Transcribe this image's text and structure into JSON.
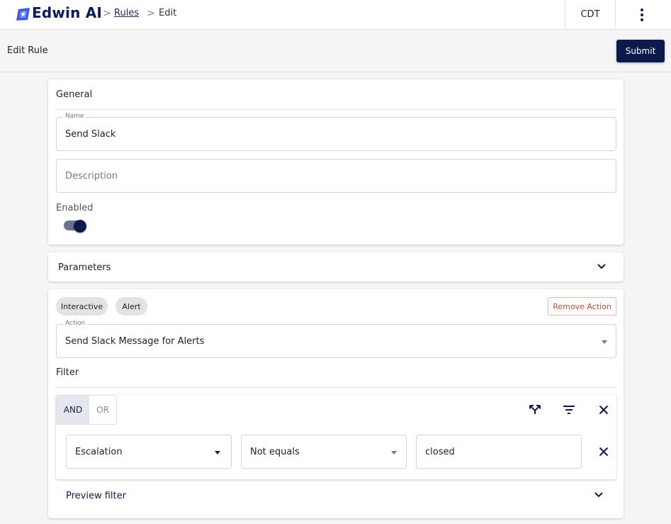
{
  "header": {
    "brand": "Edwin AI",
    "breadcrumb_sep": ">",
    "breadcrumb": [
      {
        "label": "Rules"
      },
      {
        "label": "Edit"
      }
    ],
    "timezone": "CDT"
  },
  "toolbar": {
    "page_title": "Edit Rule",
    "submit_label": "Submit"
  },
  "general": {
    "title": "General",
    "name_legend": "Name",
    "name_value": "Send Slack",
    "description_placeholder": "Description",
    "enabled_label": "Enabled",
    "enabled": true
  },
  "parameters": {
    "title": "Parameters"
  },
  "action_card": {
    "chips": [
      "Interactive",
      "Alert"
    ],
    "remove_label": "Remove Action",
    "action_legend": "Action",
    "action_value": "Send Slack Message for Alerts",
    "filter_title": "Filter",
    "logic": {
      "and": "AND",
      "or": "OR",
      "selected": "AND"
    },
    "condition": {
      "field": "Escalation",
      "operator": "Not equals",
      "value": "closed"
    },
    "preview_label": "Preview filter"
  },
  "colors": {
    "brand_navy": "#0b1a4a",
    "remove_red": "#d9442b"
  },
  "icons": [
    "logo-mark-icon",
    "chevron-down-icon",
    "more-vert-icon",
    "fork-icon",
    "filter-list-icon",
    "close-icon"
  ]
}
